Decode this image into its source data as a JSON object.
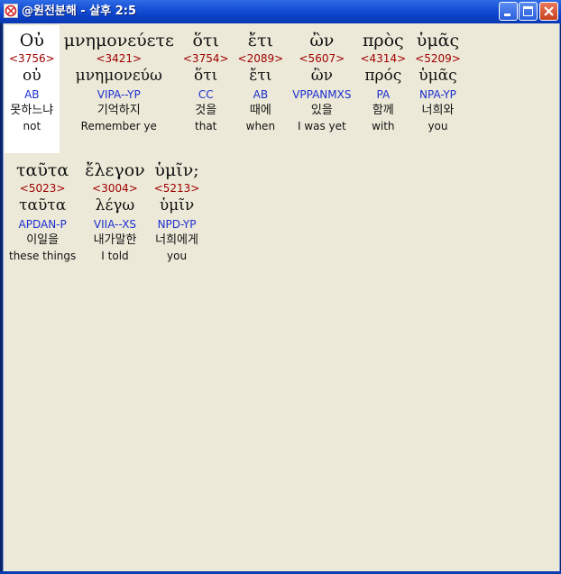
{
  "window": {
    "title": "@원전분해 - 살후 2:5"
  },
  "rows": [
    [
      {
        "greek": "Οὐ",
        "strong": "<3756>",
        "lemma": "οὐ",
        "parse": "AB",
        "korean": "못하느냐",
        "english": "not",
        "selected": true
      },
      {
        "greek": "μνημονεύετε",
        "strong": "<3421>",
        "lemma": "μνημονεύω",
        "parse": "VIPA--YP",
        "korean": "기억하지",
        "english": "Remember ye",
        "selected": false
      },
      {
        "greek": "ὅτι",
        "strong": "<3754>",
        "lemma": "ὅτι",
        "parse": "CC",
        "korean": "것을",
        "english": "that",
        "selected": false
      },
      {
        "greek": "ἔτι",
        "strong": "<2089>",
        "lemma": "ἔτι",
        "parse": "AB",
        "korean": "때에",
        "english": "when",
        "selected": false
      },
      {
        "greek": "ὢν",
        "strong": "<5607>",
        "lemma": "ὢν",
        "parse": "VPPANMXS",
        "korean": "있을",
        "english": "I was yet",
        "selected": false
      },
      {
        "greek": "πρὸς",
        "strong": "<4314>",
        "lemma": "πρός",
        "parse": "PA",
        "korean": "함께",
        "english": "with",
        "selected": false
      },
      {
        "greek": "ὑμᾶς",
        "strong": "<5209>",
        "lemma": "ὑμᾶς",
        "parse": "NPA-YP",
        "korean": "너희와",
        "english": "you",
        "selected": false
      }
    ],
    [
      {
        "greek": "ταῦτα",
        "strong": "<5023>",
        "lemma": "ταῦτα",
        "parse": "APDAN-P",
        "korean": "이일을",
        "english": "these things",
        "selected": false
      },
      {
        "greek": "ἔλεγον",
        "strong": "<3004>",
        "lemma": "λέγω",
        "parse": "VIIA--XS",
        "korean": "내가말한",
        "english": "I told",
        "selected": false
      },
      {
        "greek": "ὑμῖν;",
        "strong": "<5213>",
        "lemma": "ὑμῖν",
        "parse": "NPD-YP",
        "korean": "너희에게",
        "english": "you",
        "selected": false
      }
    ]
  ],
  "colors": {
    "strong": "#A00000",
    "parse": "#1C2FD0",
    "background": "#ECE9D8",
    "selection": "#FFFFFF"
  }
}
